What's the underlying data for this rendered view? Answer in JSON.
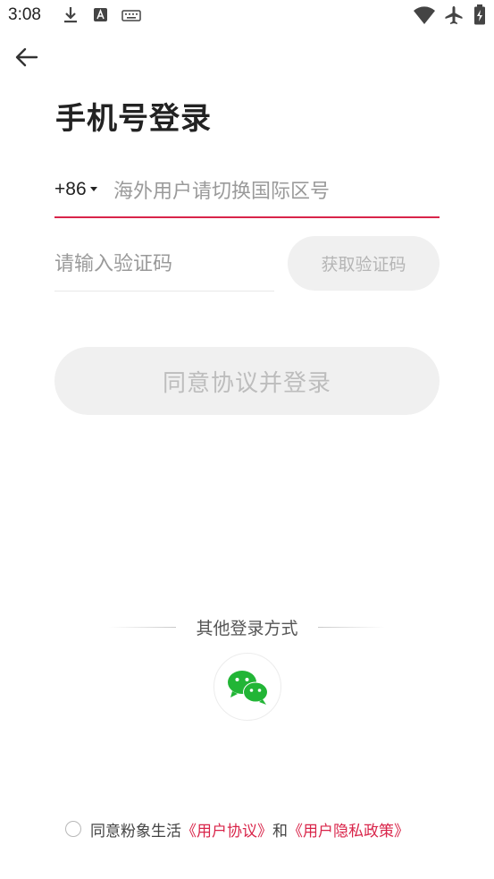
{
  "status_bar": {
    "time": "3:08",
    "left_icons": [
      "download-icon",
      "text-icon",
      "keyboard-icon"
    ],
    "right_icons": [
      "wifi-icon",
      "airplane-icon",
      "battery-icon"
    ]
  },
  "header": {
    "back_icon": "arrow-left-icon"
  },
  "page": {
    "title": "手机号登录"
  },
  "phone": {
    "country_code": "+86",
    "placeholder": "海外用户请切换国际区号",
    "value": ""
  },
  "verify": {
    "placeholder": "请输入验证码",
    "value": "",
    "get_code_label": "获取验证码"
  },
  "login": {
    "button_label": "同意协议并登录"
  },
  "other_login": {
    "label": "其他登录方式",
    "options": [
      "wechat-icon"
    ]
  },
  "agreement": {
    "prefix": "同意粉象生活",
    "user_agreement": "《用户协议》",
    "and": "和",
    "privacy_policy": "《用户隐私政策》"
  },
  "colors": {
    "accent": "#d9254a",
    "wechat_green": "#22b536",
    "disabled_bg": "#f0f0f0"
  }
}
